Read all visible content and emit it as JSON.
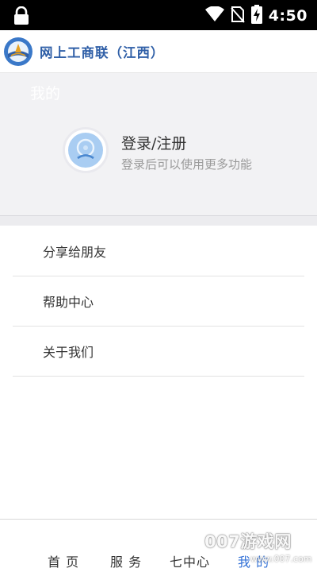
{
  "status_bar": {
    "time": "4:50",
    "icons": [
      "lock-icon",
      "wifi-icon",
      "no-sim-icon",
      "battery-charging-icon"
    ]
  },
  "header": {
    "title": "网上工商联（江西）",
    "logo": "app-logo"
  },
  "profile": {
    "tab_label": "我的",
    "login_title": "登录/注册",
    "login_subtitle": "登录后可以使用更多功能",
    "avatar_icon": "user-avatar-icon"
  },
  "menu": {
    "items": [
      {
        "label": "分享给朋友"
      },
      {
        "label": "帮助中心"
      },
      {
        "label": "关于我们"
      }
    ]
  },
  "bottom_nav": {
    "items": [
      {
        "label": "首 页"
      },
      {
        "label": "服 务"
      },
      {
        "label": "七中心"
      },
      {
        "label": "我 的"
      }
    ],
    "active": "我 的"
  },
  "watermark": {
    "text": "007游戏网",
    "sub": "www.007.com"
  },
  "colors": {
    "brand": "#2f5fa7",
    "active_tab": "#2f6fd6",
    "profile_bg": "#f2f2f4"
  }
}
